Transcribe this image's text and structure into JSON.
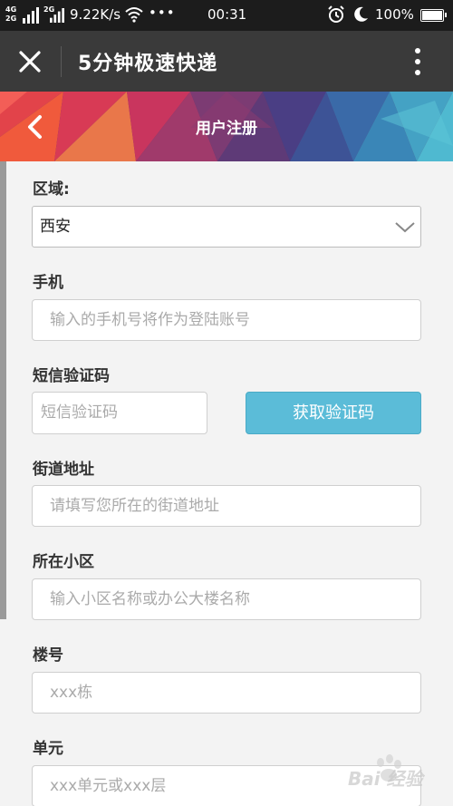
{
  "status_bar": {
    "network_top": "4G",
    "network_bottom": "2G",
    "network_2": "2G",
    "speed": "9.22K/s",
    "dots": "•••",
    "time": "00:31",
    "battery": "100%"
  },
  "app_bar": {
    "title": "5分钟极速快递"
  },
  "banner": {
    "title": "用户注册"
  },
  "form": {
    "region": {
      "label": "区域:",
      "value": "西安"
    },
    "phone": {
      "label": "手机",
      "placeholder": "输入的手机号将作为登陆账号"
    },
    "sms": {
      "label": "短信验证码",
      "placeholder": "短信验证码",
      "button": "获取验证码"
    },
    "street": {
      "label": "街道地址",
      "placeholder": "请填写您所在的街道地址"
    },
    "community": {
      "label": "所在小区",
      "placeholder": "输入小区名称或办公大楼名称"
    },
    "building": {
      "label": "楼号",
      "placeholder": "xxx栋"
    },
    "unit": {
      "label": "单元",
      "placeholder": "xxx单元或xxx层"
    }
  },
  "watermark": {
    "text": "Bai 经验"
  },
  "colors": {
    "status_bar": "#1c1c1c",
    "app_bar": "#3a3a3a",
    "accent_button": "#5bbcd8",
    "page_background": "#f3f3f3"
  }
}
